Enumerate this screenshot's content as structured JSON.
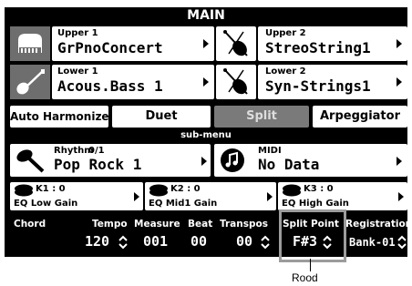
{
  "screen_title": "MAIN",
  "upper1": {
    "label": "Upper 1",
    "value": "GrPnoConcert"
  },
  "upper2": {
    "label": "Upper 2",
    "value": "StreoString1"
  },
  "lower1": {
    "label": "Lower 1",
    "value": "Acous.Bass 1"
  },
  "lower2": {
    "label": "Lower 2",
    "value": "Syn-Strings1"
  },
  "buttons": {
    "auto_harmonize": "Auto Harmonize",
    "duet": "Duet",
    "split": "Split",
    "arpeggiator": "Arpeggiator"
  },
  "submenu_label": "sub-menu",
  "rhythm": {
    "label": "Rhythm",
    "count": "0/1",
    "value": "Pop Rock 1"
  },
  "midi": {
    "label": "MIDI",
    "value": "No Data"
  },
  "eq": [
    {
      "k": "K1 : 0",
      "name": "EQ Low Gain"
    },
    {
      "k": "K2 : 0",
      "name": "EQ Mid1 Gain"
    },
    {
      "k": "K3 : 0",
      "name": "EQ High Gain"
    }
  ],
  "bottom": {
    "chord": "Chord",
    "tempo_label": "Tempo",
    "tempo_value": "120",
    "measure_label": "Measure",
    "measure_value": "001",
    "beat_label": "Beat",
    "beat_value": "00",
    "transpose_label": "Transpos",
    "transpose_value": "00",
    "split_point_label": "Split Point",
    "split_point_value": "F#3",
    "registration_label": "Registration",
    "registration_value": "Bank-01"
  },
  "callout": "Rood"
}
